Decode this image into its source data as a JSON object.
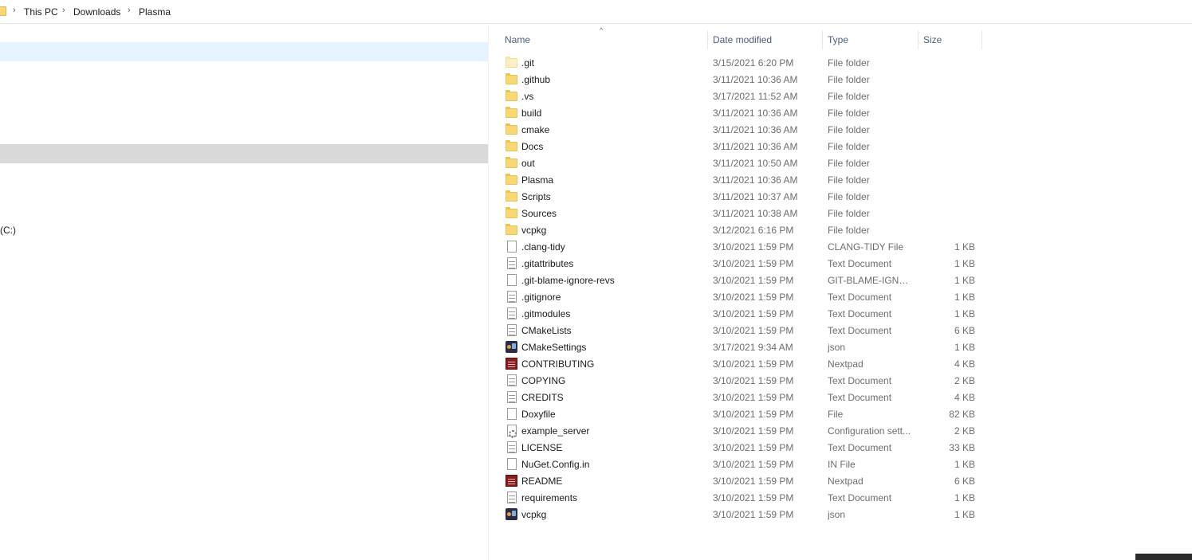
{
  "address_bar": {
    "crumbs": [
      "This PC",
      "Downloads",
      "Plasma"
    ]
  },
  "nav_pane": {
    "drive_label": "(C:)"
  },
  "columns": {
    "name": "Name",
    "date": "Date modified",
    "type": "Type",
    "size": "Size"
  },
  "files": [
    {
      "name": ".git",
      "date": "3/15/2021 6:20 PM",
      "type": "File folder",
      "size": "",
      "icon": "folder-faded"
    },
    {
      "name": ".github",
      "date": "3/11/2021 10:36 AM",
      "type": "File folder",
      "size": "",
      "icon": "folder"
    },
    {
      "name": ".vs",
      "date": "3/17/2021 11:52 AM",
      "type": "File folder",
      "size": "",
      "icon": "folder"
    },
    {
      "name": "build",
      "date": "3/11/2021 10:36 AM",
      "type": "File folder",
      "size": "",
      "icon": "folder"
    },
    {
      "name": "cmake",
      "date": "3/11/2021 10:36 AM",
      "type": "File folder",
      "size": "",
      "icon": "folder"
    },
    {
      "name": "Docs",
      "date": "3/11/2021 10:36 AM",
      "type": "File folder",
      "size": "",
      "icon": "folder"
    },
    {
      "name": "out",
      "date": "3/11/2021 10:50 AM",
      "type": "File folder",
      "size": "",
      "icon": "folder"
    },
    {
      "name": "Plasma",
      "date": "3/11/2021 10:36 AM",
      "type": "File folder",
      "size": "",
      "icon": "folder"
    },
    {
      "name": "Scripts",
      "date": "3/11/2021 10:37 AM",
      "type": "File folder",
      "size": "",
      "icon": "folder"
    },
    {
      "name": "Sources",
      "date": "3/11/2021 10:38 AM",
      "type": "File folder",
      "size": "",
      "icon": "folder"
    },
    {
      "name": "vcpkg",
      "date": "3/12/2021 6:16 PM",
      "type": "File folder",
      "size": "",
      "icon": "folder"
    },
    {
      "name": ".clang-tidy",
      "date": "3/10/2021 1:59 PM",
      "type": "CLANG-TIDY File",
      "size": "1 KB",
      "icon": "doc"
    },
    {
      "name": ".gitattributes",
      "date": "3/10/2021 1:59 PM",
      "type": "Text Document",
      "size": "1 KB",
      "icon": "text"
    },
    {
      "name": ".git-blame-ignore-revs",
      "date": "3/10/2021 1:59 PM",
      "type": "GIT-BLAME-IGNO...",
      "size": "1 KB",
      "icon": "doc"
    },
    {
      "name": ".gitignore",
      "date": "3/10/2021 1:59 PM",
      "type": "Text Document",
      "size": "1 KB",
      "icon": "text"
    },
    {
      "name": ".gitmodules",
      "date": "3/10/2021 1:59 PM",
      "type": "Text Document",
      "size": "1 KB",
      "icon": "text"
    },
    {
      "name": "CMakeLists",
      "date": "3/10/2021 1:59 PM",
      "type": "Text Document",
      "size": "6 KB",
      "icon": "text"
    },
    {
      "name": "CMakeSettings",
      "date": "3/17/2021 9:34 AM",
      "type": "json",
      "size": "1 KB",
      "icon": "json"
    },
    {
      "name": "CONTRIBUTING",
      "date": "3/10/2021 1:59 PM",
      "type": "Nextpad",
      "size": "4 KB",
      "icon": "nextpad"
    },
    {
      "name": "COPYING",
      "date": "3/10/2021 1:59 PM",
      "type": "Text Document",
      "size": "2 KB",
      "icon": "text"
    },
    {
      "name": "CREDITS",
      "date": "3/10/2021 1:59 PM",
      "type": "Text Document",
      "size": "4 KB",
      "icon": "text"
    },
    {
      "name": "Doxyfile",
      "date": "3/10/2021 1:59 PM",
      "type": "File",
      "size": "82 KB",
      "icon": "doc"
    },
    {
      "name": "example_server",
      "date": "3/10/2021 1:59 PM",
      "type": "Configuration sett...",
      "size": "2 KB",
      "icon": "config"
    },
    {
      "name": "LICENSE",
      "date": "3/10/2021 1:59 PM",
      "type": "Text Document",
      "size": "33 KB",
      "icon": "text"
    },
    {
      "name": "NuGet.Config.in",
      "date": "3/10/2021 1:59 PM",
      "type": "IN File",
      "size": "1 KB",
      "icon": "doc"
    },
    {
      "name": "README",
      "date": "3/10/2021 1:59 PM",
      "type": "Nextpad",
      "size": "6 KB",
      "icon": "nextpad"
    },
    {
      "name": "requirements",
      "date": "3/10/2021 1:59 PM",
      "type": "Text Document",
      "size": "1 KB",
      "icon": "text"
    },
    {
      "name": "vcpkg",
      "date": "3/10/2021 1:59 PM",
      "type": "json",
      "size": "1 KB",
      "icon": "json"
    }
  ]
}
